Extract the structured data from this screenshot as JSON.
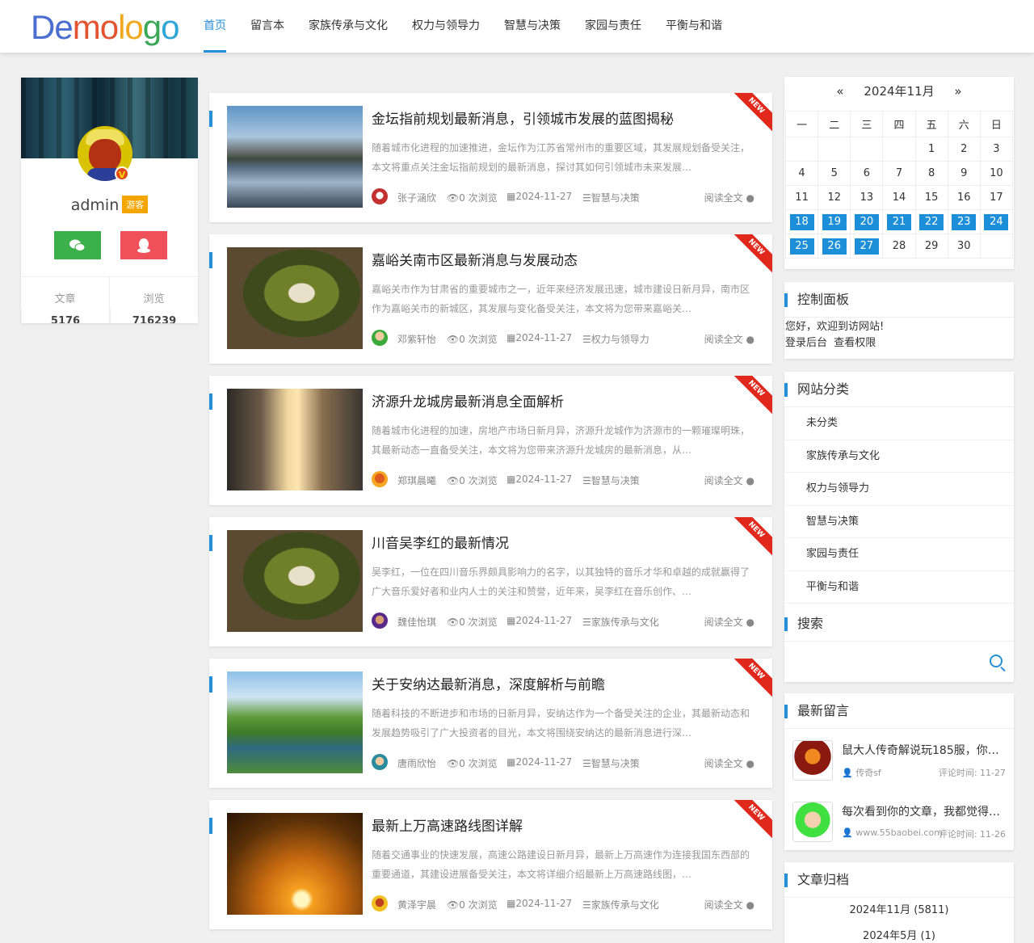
{
  "logo": {
    "p1": "De",
    "p2": "mo",
    "p3": "lo",
    "p4": "g",
    "p5": "o"
  },
  "nav": [
    "首页",
    "留言本",
    "家族传承与文化",
    "权力与领导力",
    "智慧与决策",
    "家园与责任",
    "平衡与和谐"
  ],
  "profile": {
    "name": "admin",
    "tag": "游客",
    "badge": "V",
    "stats": [
      {
        "label": "文章",
        "value": "5176"
      },
      {
        "label": "浏览",
        "value": "716239"
      }
    ]
  },
  "articles": [
    {
      "title": "金坛指前规划最新消息，引领城市发展的蓝图揭秘",
      "desc": "随着城市化进程的加速推进，金坛作为江苏省常州市的重要区域，其发展规划备受关注，本文将重点关注金坛指前规划的最新消息，探讨其如何引领城市未来发展…",
      "author": "张子涵欣",
      "views": "0 次浏览",
      "date": "2024-11-27",
      "category": "智慧与决策",
      "read": "阅读全文",
      "ribbon": "NEW"
    },
    {
      "title": "嘉峪关南市区最新消息与发展动态",
      "desc": "嘉峪关市作为甘肃省的重要城市之一，近年来经济发展迅速，城市建设日新月异，南市区作为嘉峪关市的新城区，其发展与变化备受关注，本文将为您带来嘉峪关…",
      "author": "邓紫轩怡",
      "views": "0 次浏览",
      "date": "2024-11-27",
      "category": "权力与领导力",
      "read": "阅读全文",
      "ribbon": "NEW"
    },
    {
      "title": "济源升龙城房最新消息全面解析",
      "desc": "随着城市化进程的加速，房地产市场日新月异，济源升龙城作为济源市的一颗璀璨明珠，其最新动态一直备受关注，本文将为您带来济源升龙城房的最新消息，从…",
      "author": "郑琪晨曦",
      "views": "0 次浏览",
      "date": "2024-11-27",
      "category": "智慧与决策",
      "read": "阅读全文",
      "ribbon": "NEW"
    },
    {
      "title": "川音吴李红的最新情况",
      "desc": "吴李红，一位在四川音乐界颇具影响力的名字，以其独特的音乐才华和卓越的成就赢得了广大音乐爱好者和业内人士的关注和赞誉，近年来，吴李红在音乐创作、…",
      "author": "魏佳怡琪",
      "views": "0 次浏览",
      "date": "2024-11-27",
      "category": "家族传承与文化",
      "read": "阅读全文",
      "ribbon": "NEW"
    },
    {
      "title": "关于安纳达最新消息，深度解析与前瞻",
      "desc": "随着科技的不断进步和市场的日新月异，安纳达作为一个备受关注的企业，其最新动态和发展趋势吸引了广大投资者的目光，本文将围绕安纳达的最新消息进行深…",
      "author": "唐雨欣怡",
      "views": "0 次浏览",
      "date": "2024-11-27",
      "category": "智慧与决策",
      "read": "阅读全文",
      "ribbon": "NEW"
    },
    {
      "title": "最新上万高速路线图详解",
      "desc": "随着交通事业的快速发展，高速公路建设日新月异，最新上万高速作为连接我国东西部的重要通道，其建设进展备受关注，本文将详细介绍最新上万高速路线图，…",
      "author": "黄泽宇晨",
      "views": "0 次浏览",
      "date": "2024-11-27",
      "category": "家族传承与文化",
      "read": "阅读全文",
      "ribbon": "NEW"
    }
  ],
  "calendar": {
    "prev": "«",
    "month": "2024年11月",
    "next": "»",
    "weekdays": [
      "一",
      "二",
      "三",
      "四",
      "五",
      "六",
      "日"
    ],
    "weeks": [
      [
        "",
        "",
        "",
        "",
        "1",
        "2",
        "3"
      ],
      [
        "4",
        "5",
        "6",
        "7",
        "8",
        "9",
        "10"
      ],
      [
        "11",
        "12",
        "13",
        "14",
        "15",
        "16",
        "17"
      ],
      [
        "18",
        "19",
        "20",
        "21",
        "22",
        "23",
        "24"
      ],
      [
        "25",
        "26",
        "27",
        "28",
        "29",
        "30",
        ""
      ]
    ],
    "highlighted": [
      "18",
      "19",
      "20",
      "21",
      "22",
      "23",
      "24",
      "25",
      "26",
      "27"
    ]
  },
  "control": {
    "title": "控制面板",
    "welcome": "您好，欢迎到访网站!",
    "login": "登录后台",
    "perm": "查看权限"
  },
  "categories": {
    "title": "网站分类",
    "items": [
      "未分类",
      "家族传承与文化",
      "权力与领导力",
      "智慧与决策",
      "家园与责任",
      "平衡与和谐"
    ]
  },
  "search": {
    "title": "搜索"
  },
  "messages": {
    "title": "最新留言",
    "items": [
      {
        "text": "鼠大人传奇解说玩185服，你…",
        "user": "传奇sf",
        "time": "评论时间: 11-27"
      },
      {
        "text": "每次看到你的文章，我都觉得…",
        "user": "www.55baobei.com",
        "time": "评论时间: 11-26"
      }
    ]
  },
  "archive": {
    "title": "文章归档",
    "items": [
      "2024年11月 (5811)",
      "2024年5月 (1)"
    ]
  },
  "colors": {
    "accent": "#2590d8",
    "ribbon": "#e0281c",
    "wechat": "#3cb04a",
    "qq": "#f0505a",
    "tag": "#f5a500"
  }
}
